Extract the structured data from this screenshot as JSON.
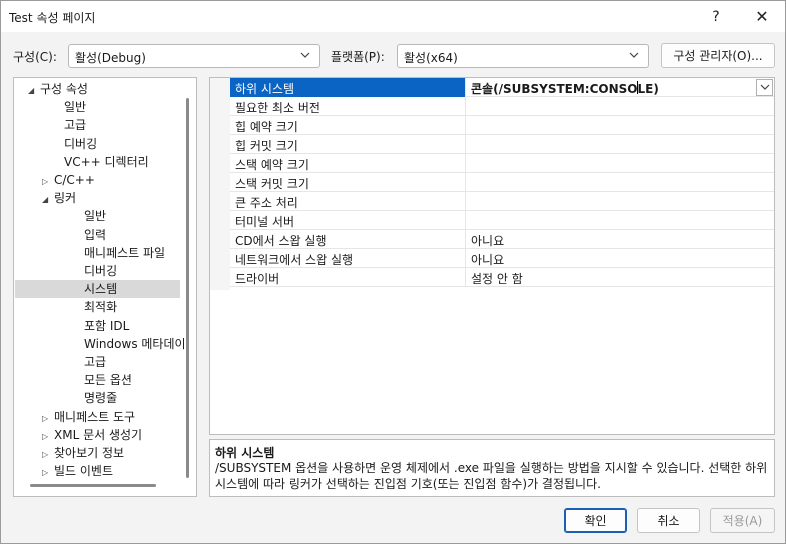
{
  "window": {
    "title": "Test 속성 페이지",
    "help": "?",
    "close": "✕"
  },
  "config": {
    "label": "구성(C):",
    "value": "활성(Debug)"
  },
  "platform": {
    "label": "플랫폼(P):",
    "value": "활성(x64)"
  },
  "config_manager": {
    "label": "구성 관리자(O)..."
  },
  "tree": {
    "items": [
      {
        "label": "구성 속성",
        "expander": "◢"
      },
      {
        "label": "일반"
      },
      {
        "label": "고급"
      },
      {
        "label": "디버깅"
      },
      {
        "label": "VC++ 디렉터리"
      },
      {
        "label": "C/C++",
        "expander": "▷"
      },
      {
        "label": "링커",
        "expander": "◢"
      },
      {
        "label": "일반"
      },
      {
        "label": "입력"
      },
      {
        "label": "매니페스트 파일"
      },
      {
        "label": "디버깅"
      },
      {
        "label": "시스템",
        "selected": true
      },
      {
        "label": "최적화"
      },
      {
        "label": "포함 IDL"
      },
      {
        "label": "Windows 메타데이"
      },
      {
        "label": "고급"
      },
      {
        "label": "모든 옵션"
      },
      {
        "label": "명령줄"
      },
      {
        "label": "매니페스트 도구",
        "expander": "▷"
      },
      {
        "label": "XML 문서 생성기",
        "expander": "▷"
      },
      {
        "label": "찾아보기 정보",
        "expander": "▷"
      },
      {
        "label": "빌드 이벤트",
        "expander": "▷"
      }
    ]
  },
  "grid": {
    "rows": [
      {
        "name": "하위 시스템",
        "value": "콘솔(/SUBSYSTEM:CONSOLE)"
      },
      {
        "name": "필요한 최소 버전",
        "value": ""
      },
      {
        "name": "힙 예약 크기",
        "value": ""
      },
      {
        "name": "힙 커밋 크기",
        "value": ""
      },
      {
        "name": "스택 예약 크기",
        "value": ""
      },
      {
        "name": "스택 커밋 크기",
        "value": ""
      },
      {
        "name": "큰 주소 처리",
        "value": ""
      },
      {
        "name": "터미널 서버",
        "value": ""
      },
      {
        "name": "CD에서 스왑 실행",
        "value": "아니요"
      },
      {
        "name": "네트워크에서 스왑 실행",
        "value": "아니요"
      },
      {
        "name": "드라이버",
        "value": "설정 안 함"
      }
    ]
  },
  "description": {
    "title": "하위 시스템",
    "body": "/SUBSYSTEM 옵션을 사용하면 운영 체제에서 .exe 파일을 실행하는 방법을 지시할 수 있습니다. 선택한 하위 시스템에 따라 링커가 선택하는 진입점 기호(또는 진입점 함수)가 결정됩니다."
  },
  "buttons": {
    "ok": "확인",
    "cancel": "취소",
    "apply": "적용(A)"
  },
  "colors": {
    "selection": "#0a64c4",
    "tree_selection": "#d9d9d9"
  }
}
